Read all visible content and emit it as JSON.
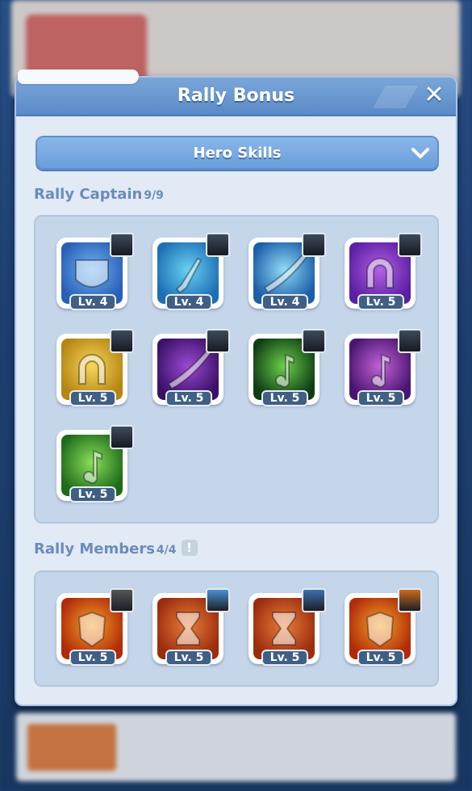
{
  "modal": {
    "title": "Rally Bonus",
    "close_icon": "close-icon"
  },
  "dropdown": {
    "selected": "Hero Skills",
    "icon": "chevron-down-icon"
  },
  "rally_captain": {
    "label": "Rally Captain",
    "count": "9/9",
    "skills": [
      {
        "level": "Lv. 4",
        "icon": "bison-shield-icon",
        "colors": [
          "#2a5fb8",
          "#6fb4ef"
        ]
      },
      {
        "level": "Lv. 4",
        "icon": "lightning-dagger-icon",
        "colors": [
          "#1f6fb3",
          "#67d2f4"
        ]
      },
      {
        "level": "Lv. 4",
        "icon": "wind-slash-icon",
        "colors": [
          "#1c5ea8",
          "#8fdcf7"
        ]
      },
      {
        "level": "Lv. 5",
        "icon": "lightning-horseshoe-icon",
        "colors": [
          "#5b1fa3",
          "#b460e4"
        ]
      },
      {
        "level": "Lv. 5",
        "icon": "golden-horseshoe-icon",
        "colors": [
          "#b58612",
          "#f6d65a"
        ]
      },
      {
        "level": "Lv. 5",
        "icon": "dark-strike-icon",
        "colors": [
          "#3c1168",
          "#9a4bd3"
        ]
      },
      {
        "level": "Lv. 5",
        "icon": "green-spirit-music-icon",
        "colors": [
          "#0f3d14",
          "#6ccf4b"
        ]
      },
      {
        "level": "Lv. 5",
        "icon": "purple-music-icon",
        "colors": [
          "#4a1570",
          "#c163d6"
        ]
      },
      {
        "level": "Lv. 5",
        "icon": "green-treble-clef-icon",
        "colors": [
          "#1e6b1b",
          "#8be05a"
        ]
      }
    ]
  },
  "rally_members": {
    "label": "Rally Members",
    "count": "4/4",
    "info_icon": "exclamation-icon",
    "skills": [
      {
        "level": "Lv. 5",
        "icon": "armor-sword-icon",
        "colors": [
          "#b12b07",
          "#f4a12c"
        ],
        "owner_color": "#555555"
      },
      {
        "level": "Lv. 5",
        "icon": "hourglass-arrows-icon",
        "colors": [
          "#9a2d0d",
          "#ea7d3a"
        ],
        "owner_color": "#4a8fd1"
      },
      {
        "level": "Lv. 5",
        "icon": "hourglass-arrows-icon",
        "colors": [
          "#9a2d0d",
          "#ea7d3a"
        ],
        "owner_color": "#3d6fb0"
      },
      {
        "level": "Lv. 5",
        "icon": "armor-sword-icon",
        "colors": [
          "#b12b07",
          "#f4a12c"
        ],
        "owner_color": "#c96a1f"
      }
    ]
  }
}
